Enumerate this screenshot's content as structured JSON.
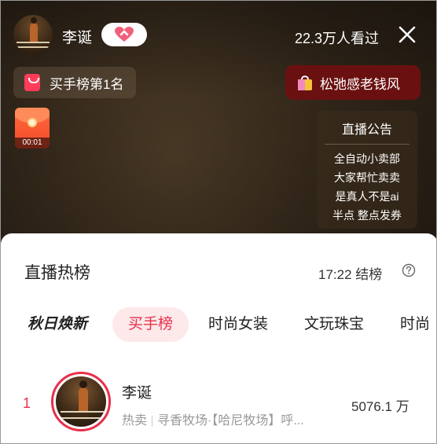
{
  "host": {
    "name": "李诞",
    "viewers": "22.3万人看过"
  },
  "rank_pill": {
    "label": "买手榜第1名"
  },
  "shop_pill": {
    "label": "松弛感老钱风"
  },
  "red_packet": {
    "timer": "00:01"
  },
  "announcement": {
    "title": "直播公告",
    "lines": [
      "全自动小卖部",
      "大家帮忙卖卖",
      "是真人不是ai",
      "半点 整点发券"
    ]
  },
  "sheet": {
    "title": "直播热榜",
    "end_time": "17:22 结榜",
    "tabs": [
      "秋日焕新",
      "买手榜",
      "时尚女装",
      "文玩珠宝",
      "时尚"
    ],
    "active_tab": "买手榜"
  },
  "ranking": [
    {
      "rank": "1",
      "name": "李诞",
      "tag": "热卖",
      "desc": "寻香牧场·【哈尼牧场】呼...",
      "value": "5076.1 万"
    }
  ],
  "colors": {
    "accent": "#e8304a",
    "shop_pill_bg": "#6a1010",
    "tab_active_bg": "#fde8ea"
  }
}
